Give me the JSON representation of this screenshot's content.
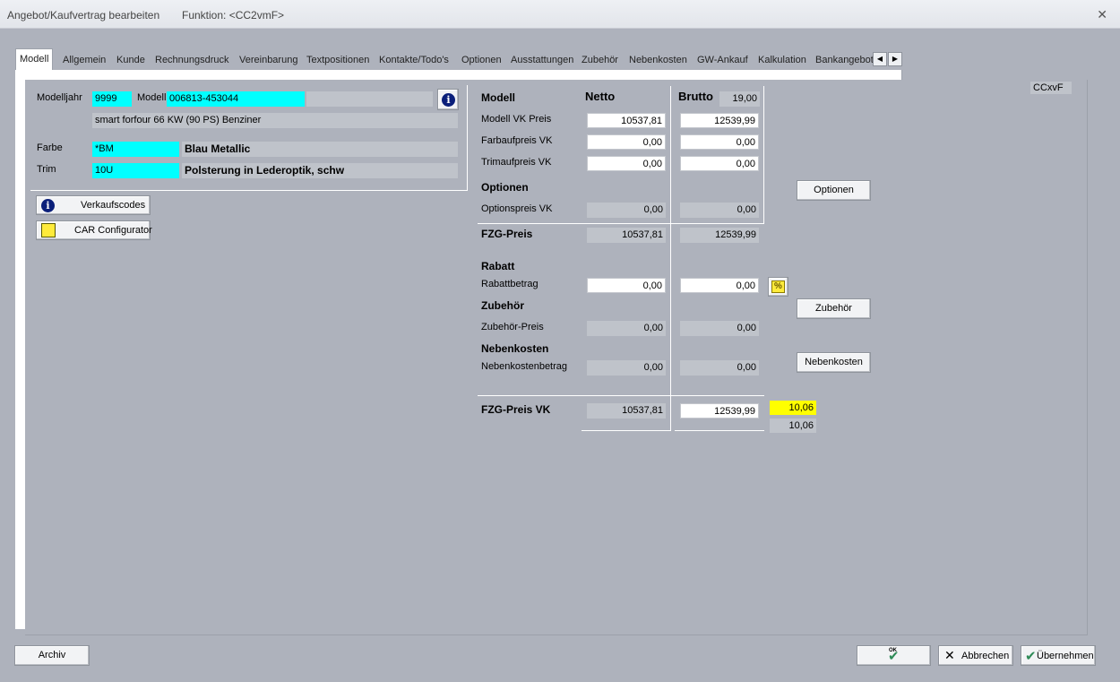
{
  "window": {
    "title": "Angebot/Kaufvertrag bearbeiten",
    "function": "Funktion: <CC2vmF>"
  },
  "tabs": [
    "Modell",
    "Allgemein",
    "Kunde",
    "Rechnungsdruck",
    "Vereinbarung",
    "Textpositionen",
    "Kontakte/Todo's",
    "Optionen",
    "Ausstattungen",
    "Zubehör",
    "Nebenkosten",
    "GW-Ankauf",
    "Kalkulation",
    "Bankangebot"
  ],
  "code_label": "CCxvF",
  "vehicle": {
    "modelljahr_label": "Modelljahr",
    "modelljahr_value": "9999",
    "modell_label": "Modell",
    "modell_value": "006813-453044",
    "modell_desc": "smart forfour 66 KW (90 PS) Benziner",
    "farbe_label": "Farbe",
    "farbe_code": "*BM",
    "farbe_name": "Blau Metallic",
    "trim_label": "Trim",
    "trim_code": "10U",
    "trim_name": "Polsterung in Lederoptik, schw"
  },
  "left_buttons": {
    "verkaufscodes": "Verkaufscodes",
    "car_configurator": "CAR Configurator"
  },
  "pricing": {
    "modell_header": "Modell",
    "netto_header": "Netto",
    "brutto_header": "Brutto",
    "vat_rate": "19,00",
    "modell_vk_label": "Modell VK Preis",
    "modell_vk_netto": "10537,81",
    "modell_vk_brutto": "12539,99",
    "farbaufpreis_label": "Farbaufpreis VK",
    "farbaufpreis_netto": "0,00",
    "farbaufpreis_brutto": "0,00",
    "trimaufpreis_label": "Trimaufpreis VK",
    "trimaufpreis_netto": "0,00",
    "trimaufpreis_brutto": "0,00",
    "optionen_header": "Optionen",
    "optionspreis_label": "Optionspreis VK",
    "optionspreis_netto": "0,00",
    "optionspreis_brutto": "0,00",
    "fzg_preis_label": "FZG-Preis",
    "fzg_preis_netto": "10537,81",
    "fzg_preis_brutto": "12539,99",
    "rabatt_header": "Rabatt",
    "rabattbetrag_label": "Rabattbetrag",
    "rabattbetrag_netto": "0,00",
    "rabattbetrag_brutto": "0,00",
    "zubehoer_header": "Zubehör",
    "zubehoer_preis_label": "Zubehör-Preis",
    "zubehoer_preis_netto": "0,00",
    "zubehoer_preis_brutto": "0,00",
    "nebenkosten_header": "Nebenkosten",
    "nebenkostenbetrag_label": "Nebenkostenbetrag",
    "nebenkostenbetrag_netto": "0,00",
    "nebenkostenbetrag_brutto": "0,00",
    "fzg_preis_vk_label": "FZG-Preis VK",
    "fzg_preis_vk_netto": "10537,81",
    "fzg_preis_vk_brutto": "12539,99",
    "margin_yellow": "10,06",
    "margin_gray": "10,06"
  },
  "right_buttons": {
    "optionen": "Optionen",
    "zubehoer": "Zubehör",
    "nebenkosten": "Nebenkosten"
  },
  "footer": {
    "archiv": "Archiv",
    "ok": "OK",
    "abbrechen": "Abbrechen",
    "uebernehmen": "Übernehmen"
  },
  "colors": {
    "background": "#aeb2bc",
    "cyan": "#00ffff",
    "yellow": "#ffff00"
  }
}
